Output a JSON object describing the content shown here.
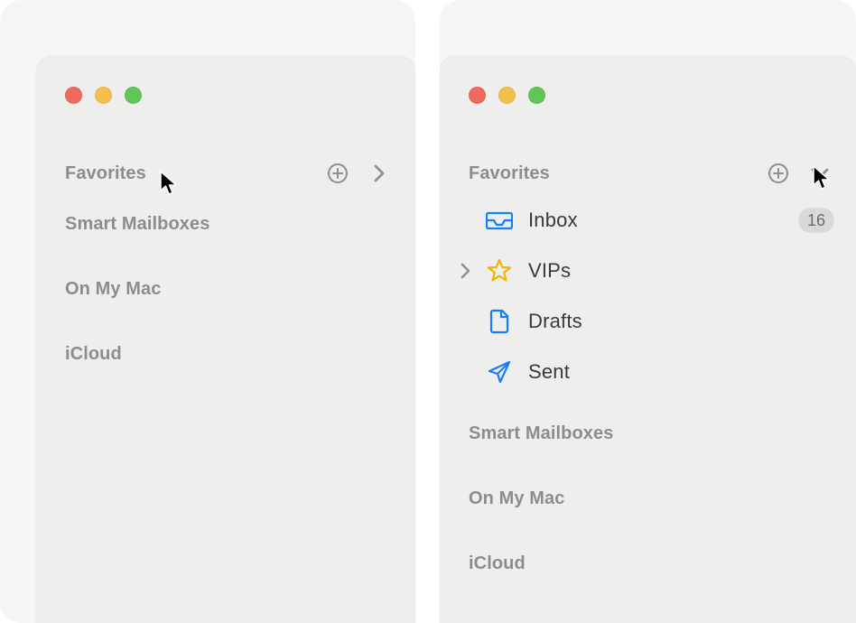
{
  "panels": {
    "left": {
      "sections": [
        "Favorites",
        "Smart Mailboxes",
        "On My Mac",
        "iCloud"
      ],
      "fav_open": false,
      "fav_hover": true
    },
    "right": {
      "sections": [
        "Favorites",
        "Smart Mailboxes",
        "On My Mac",
        "iCloud"
      ],
      "fav_open": true,
      "fav_hover": true,
      "favorites": [
        {
          "label": "Inbox",
          "icon": "inbox-icon",
          "badge": "16"
        },
        {
          "label": "VIPs",
          "icon": "star-icon",
          "disclosure": true
        },
        {
          "label": "Drafts",
          "icon": "doc-icon"
        },
        {
          "label": "Sent",
          "icon": "send-icon"
        }
      ]
    }
  },
  "colors": {
    "accent": "#157efb",
    "star": "#f2b400"
  }
}
